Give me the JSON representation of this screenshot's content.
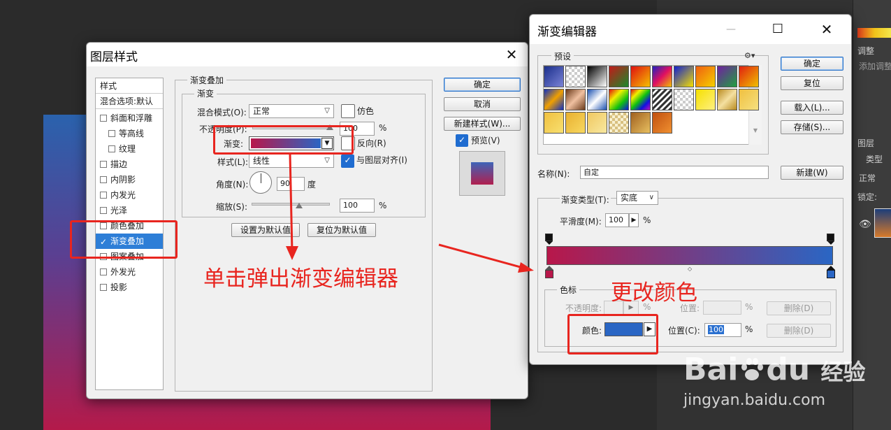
{
  "layer_style": {
    "title": "图层样式",
    "style_header": "样式",
    "blend_options": "混合选项:默认",
    "effects": [
      {
        "label": "斜面和浮雕",
        "checked": false,
        "sub": false
      },
      {
        "label": "等高线",
        "checked": false,
        "sub": true
      },
      {
        "label": "纹理",
        "checked": false,
        "sub": true
      },
      {
        "label": "描边",
        "checked": false,
        "sub": false
      },
      {
        "label": "内阴影",
        "checked": false,
        "sub": false
      },
      {
        "label": "内发光",
        "checked": false,
        "sub": false
      },
      {
        "label": "光泽",
        "checked": false,
        "sub": false
      },
      {
        "label": "颜色叠加",
        "checked": false,
        "sub": false
      },
      {
        "label": "渐变叠加",
        "checked": true,
        "sub": false
      },
      {
        "label": "图案叠加",
        "checked": false,
        "sub": false
      },
      {
        "label": "外发光",
        "checked": false,
        "sub": false
      },
      {
        "label": "投影",
        "checked": false,
        "sub": false
      }
    ],
    "panel_title": "渐变叠加",
    "group_title": "渐变",
    "blend_mode_label": "混合模式(O):",
    "blend_mode_value": "正常",
    "dither_label": "仿色",
    "opacity_label": "不透明度(P):",
    "opacity_value": "100",
    "percent": "%",
    "gradient_label": "渐变:",
    "reverse_label": "反向(R)",
    "style_label": "样式(L):",
    "style_value": "线性",
    "align_label": "与图层对齐(I)",
    "angle_label": "角度(N):",
    "angle_value": "90",
    "degree": "度",
    "scale_label": "缩放(S):",
    "scale_value": "100",
    "set_default": "设置为默认值",
    "reset_default": "复位为默认值",
    "ok": "确定",
    "cancel": "取消",
    "new_style": "新建样式(W)...",
    "preview_label": "预览(V)"
  },
  "gradient_editor": {
    "title": "渐变编辑器",
    "presets_label": "预设",
    "ok": "确定",
    "reset": "复位",
    "load": "载入(L)...",
    "save": "存储(S)...",
    "name_label": "名称(N):",
    "name_value": "自定",
    "new_button": "新建(W)",
    "gradient_type_label": "渐变类型(T):",
    "gradient_type_value": "实底",
    "smoothness_label": "平滑度(M):",
    "smoothness_value": "100",
    "percent": "%",
    "stops_group": "色标",
    "opacity_label": "不透明度:",
    "location_label_disabled": "位置:",
    "delete_label": "删除(D)",
    "color_label": "颜色:",
    "location_label": "位置(C):",
    "location_value": "100"
  },
  "annotations": {
    "click_popup": "单击弹出渐变编辑器",
    "change_color": "更改颜色"
  },
  "photoshop_right": {
    "adjust_tab": "调整",
    "add_adjust": "添加调整",
    "layers_tab": "图层",
    "kind_label": "类型",
    "normal_label": "正常",
    "lock_label": "锁定:"
  },
  "watermark": {
    "brand": "Bai",
    "brand2": "du",
    "jingyan": "经验",
    "url": "jingyan.baidu.com"
  },
  "colors": {
    "gradient_start": "#b8174a",
    "gradient_end": "#2a66c4",
    "annotation_red": "#e8251f"
  }
}
